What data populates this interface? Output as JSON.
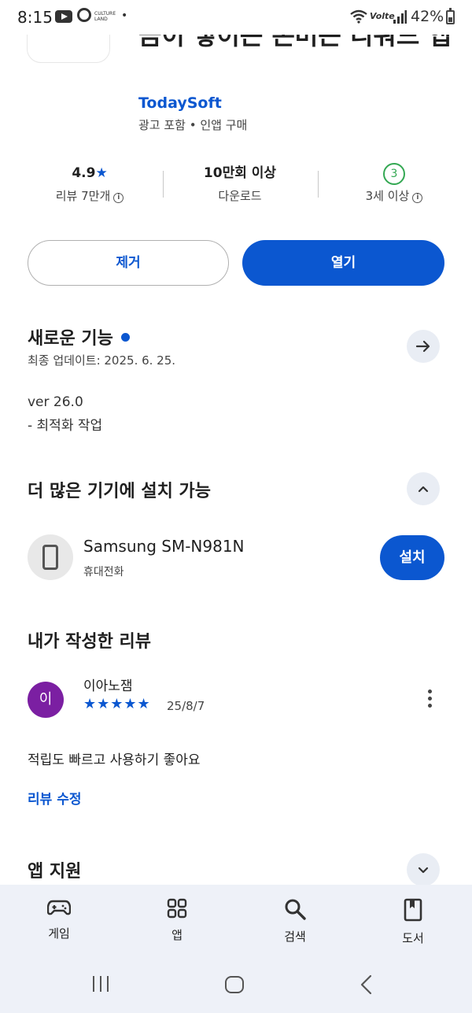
{
  "status_bar": {
    "time": "8:15",
    "culture_badge": "CULTURE LAND",
    "dot": "•",
    "network": "Volte",
    "battery": "42%"
  },
  "app": {
    "title": "금이 쌓이는 돈버는 리워드 앱",
    "developer": "TodaySoft",
    "meta": "광고 포함 • 인앱 구매"
  },
  "stats": {
    "rating_value": "4.9",
    "rating_star": "★",
    "reviews_label": "리뷰 7만개",
    "downloads_value": "10만회 이상",
    "downloads_label": "다운로드",
    "age_badge": "3",
    "age_label": "3세 이상",
    "info_glyph": "i"
  },
  "actions": {
    "remove_label": "제거",
    "open_label": "열기"
  },
  "whats_new": {
    "title": "새로운 기능",
    "last_updated": "최종 업데이트: 2025. 6. 25.",
    "notes": [
      "ver 26.0",
      "- 최적화 작업"
    ]
  },
  "devices": {
    "title": "더 많은 기기에 설치 가능",
    "device_name": "Samsung SM-N981N",
    "device_type": "휴대전화",
    "install_label": "설치"
  },
  "my_review": {
    "title": "내가 작성한 리뷰",
    "avatar_initial": "이",
    "reviewer": "이아노잼",
    "stars": "★★★★★",
    "rating": 5,
    "date": "25/8/7",
    "text": "적립도 빠르고 사용하기 좋아요",
    "edit_label": "리뷰 수정"
  },
  "app_support": {
    "title": "앱 지원"
  },
  "bottom_nav": {
    "items": [
      {
        "label": "게임",
        "icon": "gamepad-icon"
      },
      {
        "label": "앱",
        "icon": "apps-grid-icon"
      },
      {
        "label": "검색",
        "icon": "search-icon"
      },
      {
        "label": "도서",
        "icon": "book-icon"
      }
    ]
  },
  "colors": {
    "accent": "#0b57d0",
    "age_badge": "#34a853",
    "avatar": "#7b1fa2",
    "nav_bg": "#eef1f8"
  }
}
